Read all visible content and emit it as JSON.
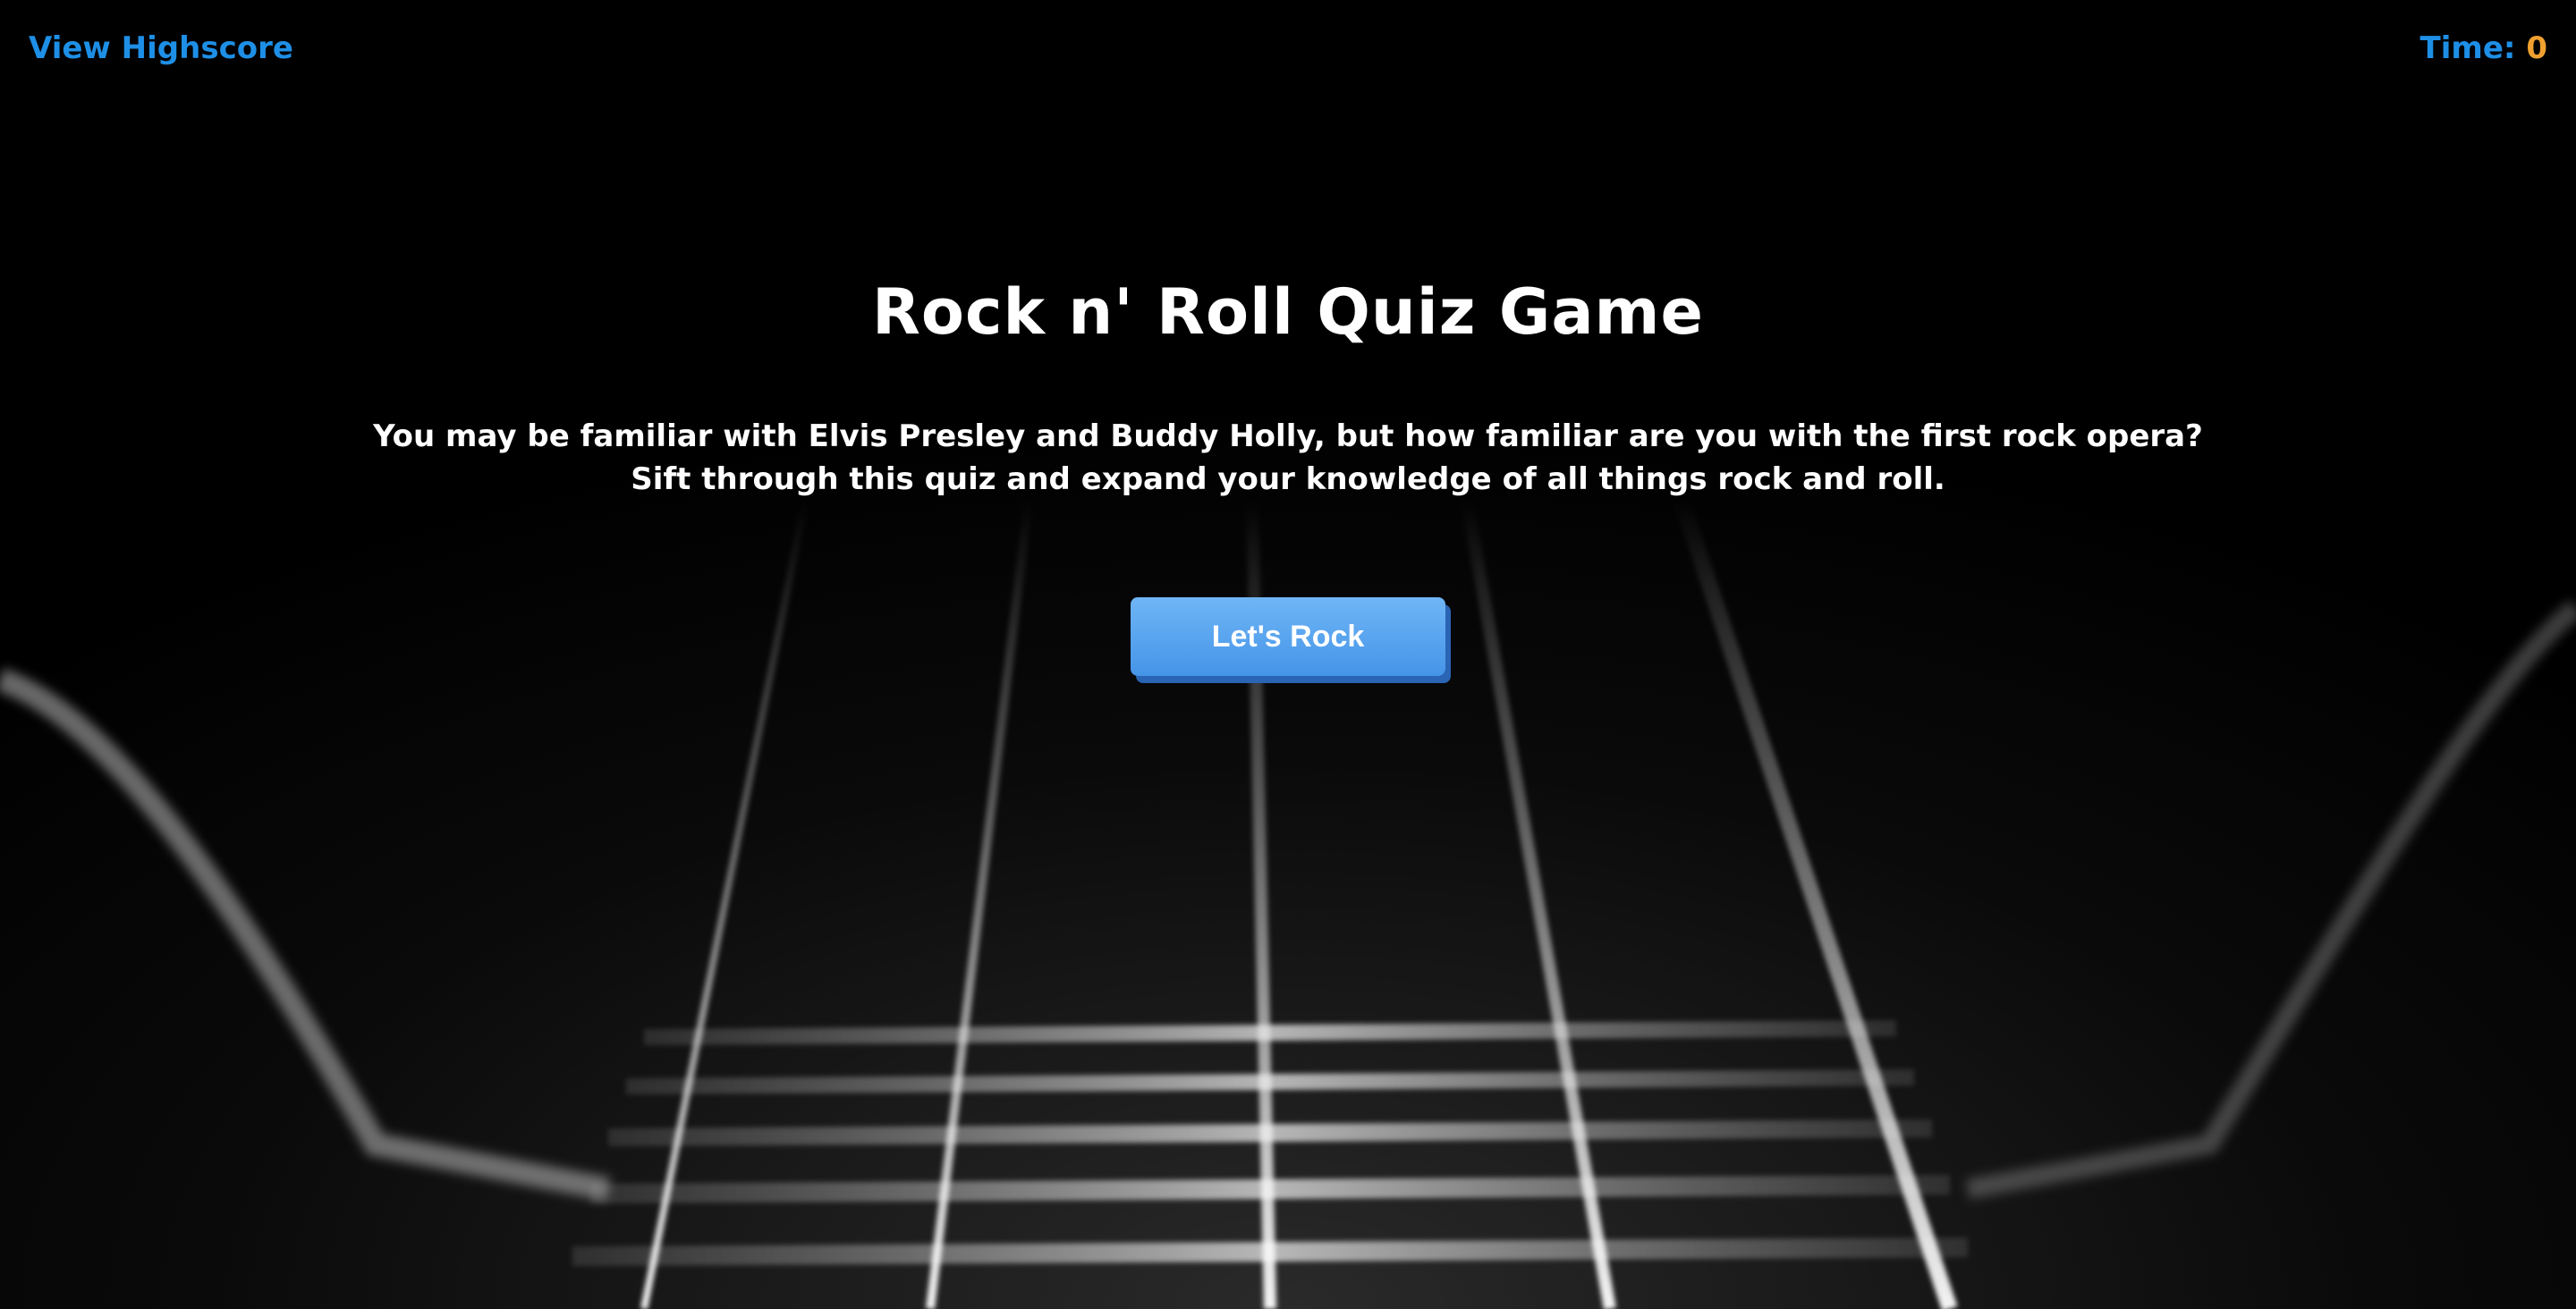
{
  "header": {
    "highscore_label": "View Highscore",
    "time_label": "Time:",
    "time_value": "0"
  },
  "intro": {
    "title": "Rock n' Roll Quiz Game",
    "description_line1": "You may be familiar with Elvis Presley and Buddy Holly, but how familiar are you with the first rock opera?",
    "description_line2": "Sift through this quiz and expand your knowledge of all things rock and roll.",
    "start_button_label": "Let's Rock"
  },
  "colors": {
    "link": "#1e8fe6",
    "timer_value": "#f0a030",
    "button": "#4594e8",
    "background": "#000000"
  },
  "background_image": "guitar-strings-closeup"
}
